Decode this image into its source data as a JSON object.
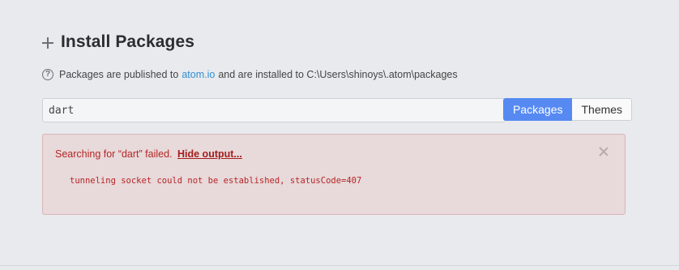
{
  "header": {
    "title": "Install Packages",
    "icon": "plus-icon"
  },
  "info": {
    "icon": "question-circle-icon",
    "text_before": "Packages are published to",
    "link_text": "atom.io",
    "text_after": "and are installed to C:\\Users\\shinoys\\.atom\\packages"
  },
  "search": {
    "value": "dart"
  },
  "toggle": {
    "packages_label": "Packages",
    "themes_label": "Themes",
    "selected": "Packages",
    "accent_color": "#568af2"
  },
  "alert": {
    "message": "Searching for “dart” failed.",
    "hide_label": "Hide output...",
    "output": "tunneling socket could not be established, statusCode=407",
    "close_icon": "close-icon",
    "text_color": "#b52626",
    "background_color": "#e8d9da"
  }
}
